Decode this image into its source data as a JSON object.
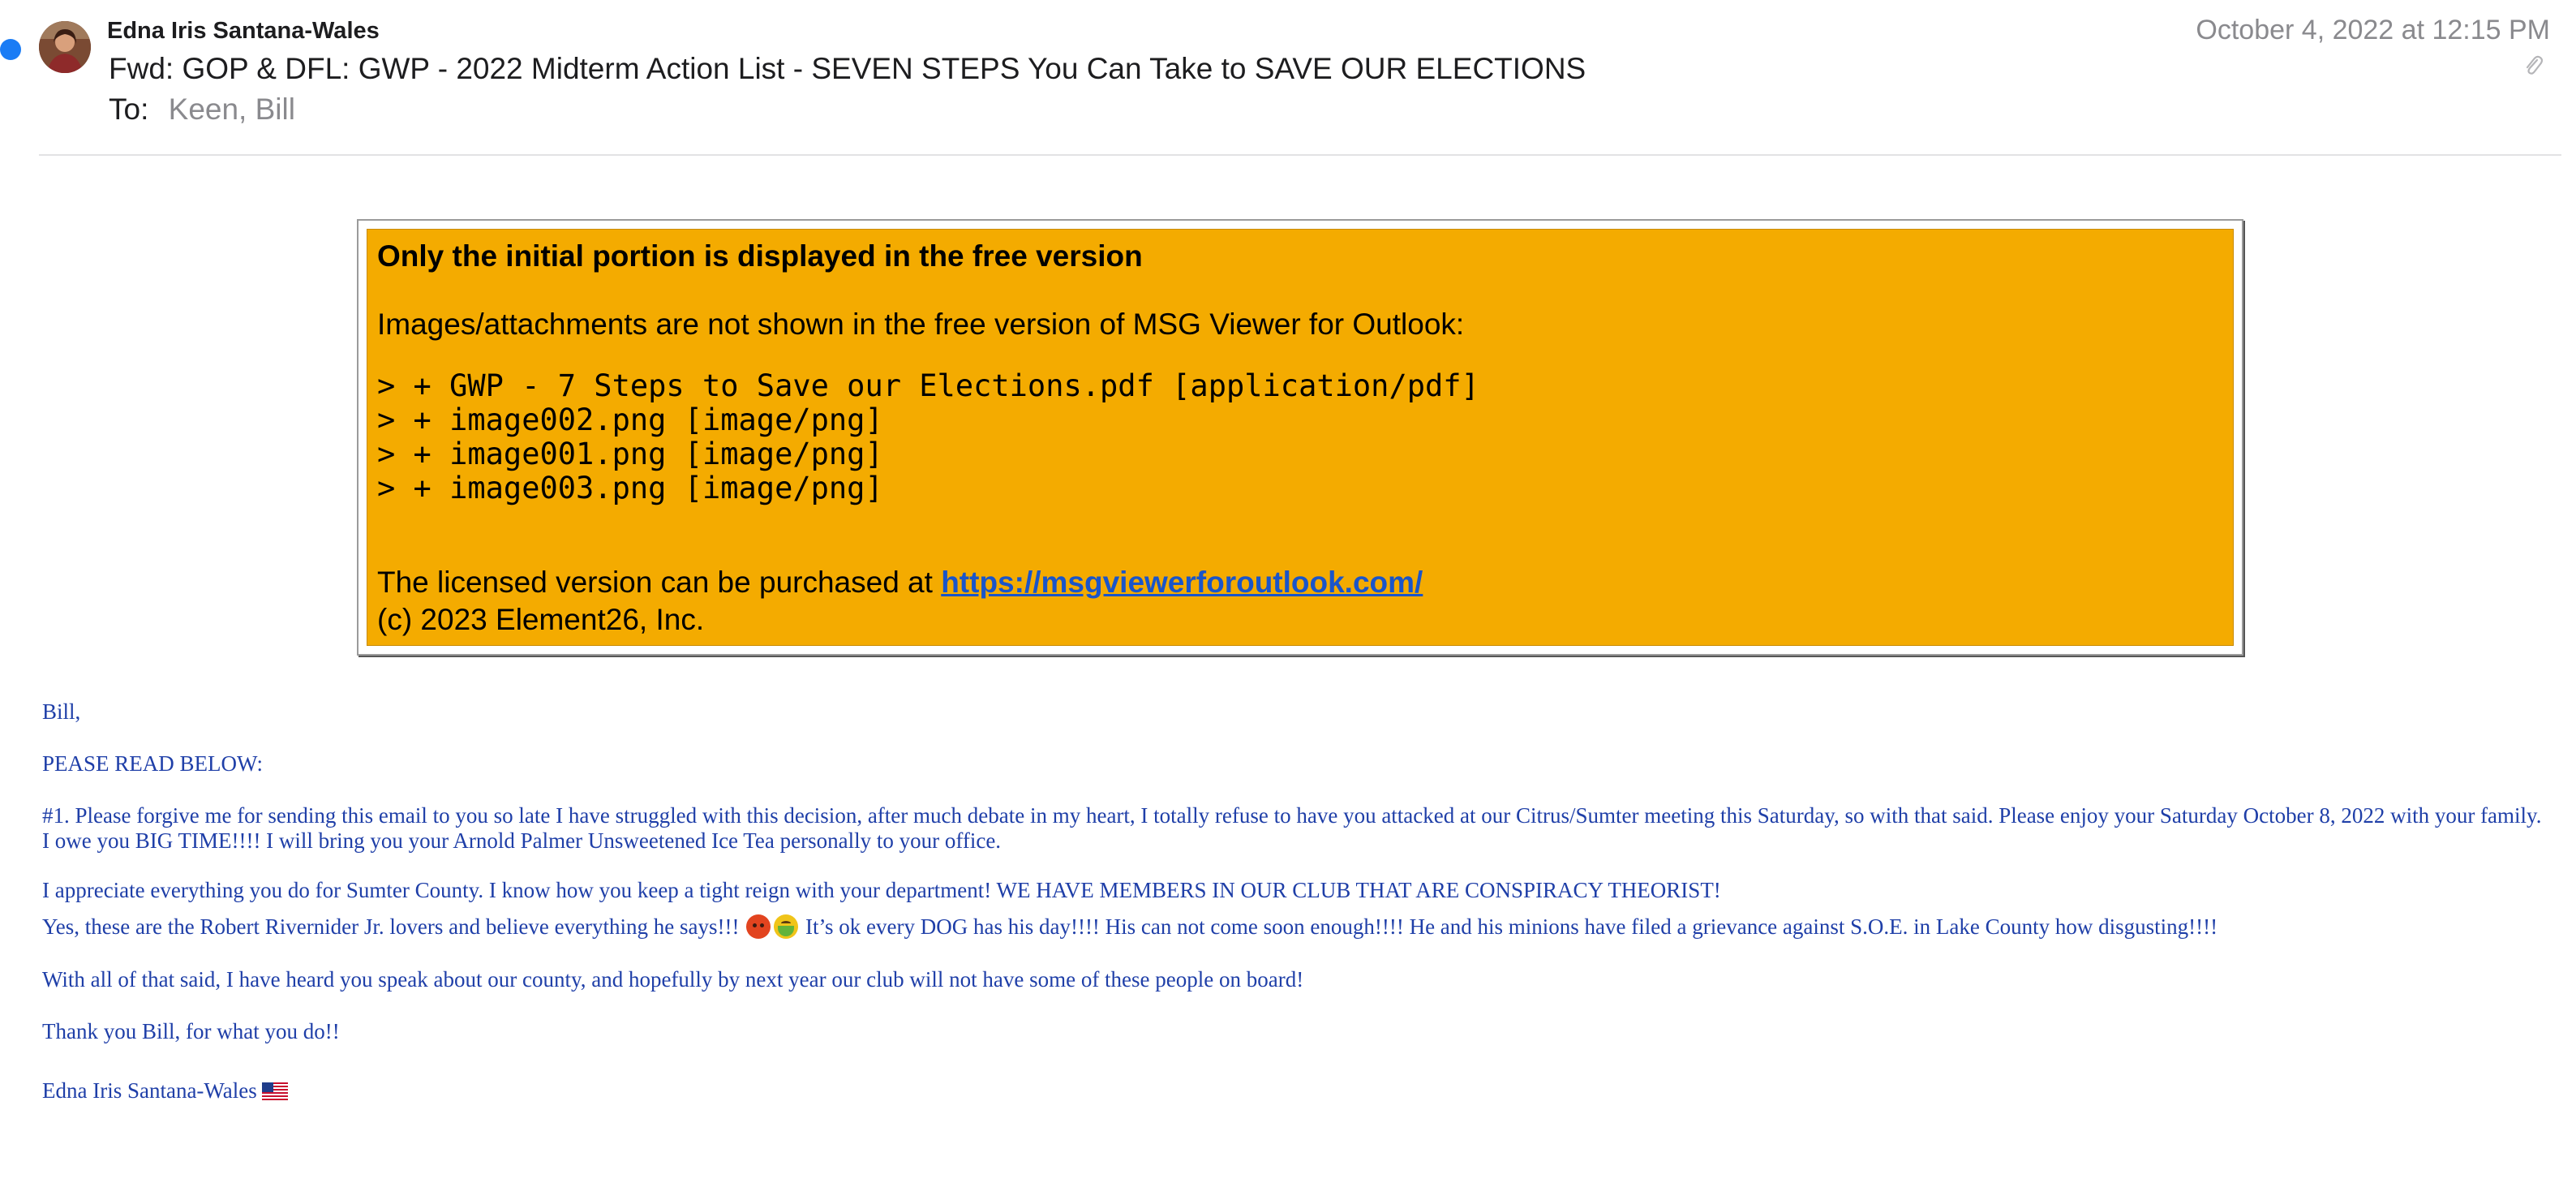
{
  "header": {
    "sender_name": "Edna Iris Santana-Wales",
    "subject": "Fwd: GOP & DFL: GWP - 2022 Midterm Action List - SEVEN STEPS You Can Take to SAVE OUR ELECTIONS",
    "to_label": "To:",
    "to_value": "Keen, Bill",
    "date": "October 4, 2022 at 12:15 PM",
    "unread": true,
    "has_attachment_icon": "paperclip-icon"
  },
  "notice": {
    "title": "Only the initial portion is displayed in the free version",
    "subtitle": "Images/attachments are not shown in the free version of MSG Viewer for Outlook:",
    "attachments": [
      "> + GWP - 7 Steps to Save our Elections.pdf [application/pdf]",
      "> + image002.png [image/png]",
      "> + image001.png [image/png]",
      "> + image003.png [image/png]"
    ],
    "license_prefix": "The licensed version can be purchased at ",
    "license_link": "https://msgviewerforoutlook.com/",
    "copyright": "(c) 2023 Element26, Inc.",
    "background_color": "#f4ab00"
  },
  "body": {
    "text_color": "#1f3fa8",
    "greeting": "Bill,",
    "read_below": "PEASE READ BELOW:",
    "paragraph_1": "#1. Please forgive me for sending this email to you so late I have struggled with this decision, after much debate in my heart, I totally refuse to have you attacked at our Citrus/Sumter meeting this Saturday, so with that said. Please enjoy your Saturday October 8, 2022 with your family. I owe you BIG TIME!!!! I will bring you your Arnold Palmer Unsweetened Ice Tea personally to your office.",
    "appreciate": "I appreciate everything you do for Sumter County. I know how you keep a tight reign with your department! WE HAVE MEMBERS IN OUR CLUB THAT ARE CONSPIRACY THEORIST!",
    "yes_part1": "Yes, these are the Robert Rivernider Jr. lovers and believe everything he says!!!",
    "yes_part2": "It’s ok every DOG has his day!!!! His can not come soon enough!!!! He and his minions have filed a grievance against S.O.E. in Lake County how disgusting!!!!",
    "with_all": "With all of that said, I have heard you speak about our county, and hopefully by next year our club will not have some of these people on board!",
    "thanks": "Thank you Bill, for what you do!!",
    "signature": "Edna Iris Santana-Wales",
    "emojis": [
      "angry-face-emoji",
      "nauseated-face-emoji"
    ],
    "signature_flag": "us-flag-emoji"
  }
}
